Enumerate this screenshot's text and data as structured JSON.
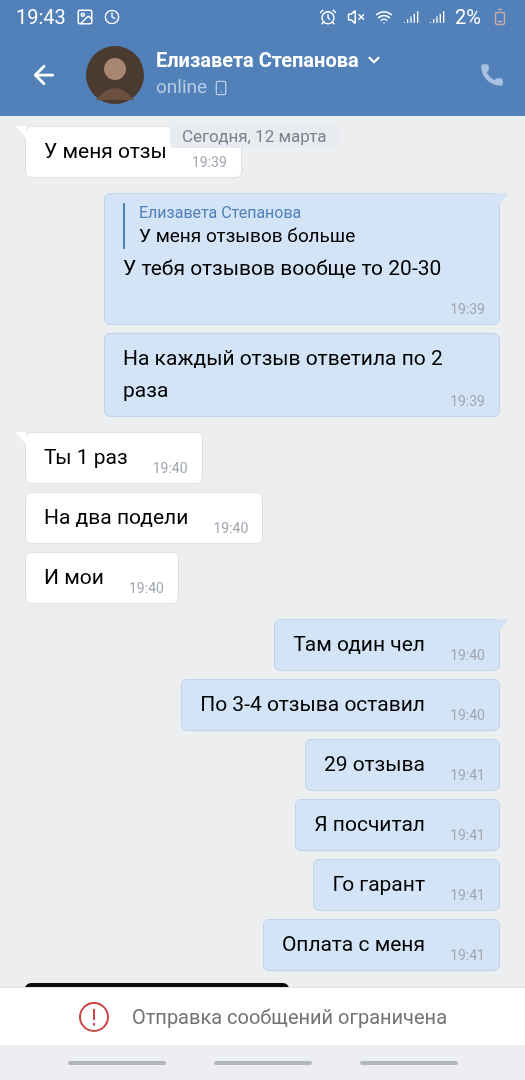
{
  "status_bar": {
    "time": "19:43",
    "battery": "2%"
  },
  "header": {
    "name": "Елизавета Степанова",
    "status": "online"
  },
  "date_badge": "Сегодня, 12 марта",
  "messages": [
    {
      "kind": "incoming",
      "tail": true,
      "text": "У меня отзы",
      "time": "19:39"
    },
    {
      "kind": "outgoing",
      "tail": true,
      "reply": {
        "author": "Елизавета Степанова",
        "text": "У меня отзывов больше"
      },
      "text": "У тебя отзывов вообще то 20-30",
      "time": "19:39"
    },
    {
      "kind": "outgoing",
      "tail": false,
      "text": "На каждый отзыв ответила по 2 раза",
      "time": "19:39"
    },
    {
      "kind": "incoming",
      "tail": true,
      "text": "Ты 1 раз",
      "time": "19:40"
    },
    {
      "kind": "incoming",
      "tail": false,
      "text": "На два подели",
      "time": "19:40"
    },
    {
      "kind": "incoming",
      "tail": false,
      "text": "И мои",
      "time": "19:40"
    },
    {
      "kind": "outgoing",
      "tail": true,
      "text": "Там один чел",
      "time": "19:40"
    },
    {
      "kind": "outgoing",
      "tail": false,
      "text": "По 3-4 отзыва оставил",
      "time": "19:40"
    },
    {
      "kind": "outgoing",
      "tail": false,
      "text": "29 отзыва",
      "time": "19:41"
    },
    {
      "kind": "outgoing",
      "tail": false,
      "text": "Я посчитал",
      "time": "19:41"
    },
    {
      "kind": "outgoing",
      "tail": false,
      "text": "Го гарант",
      "time": "19:41"
    },
    {
      "kind": "outgoing",
      "tail": false,
      "text": "Оплата с меня",
      "time": "19:41"
    },
    {
      "kind": "picture"
    }
  ],
  "notice": "Отправка сообщений ограничена"
}
